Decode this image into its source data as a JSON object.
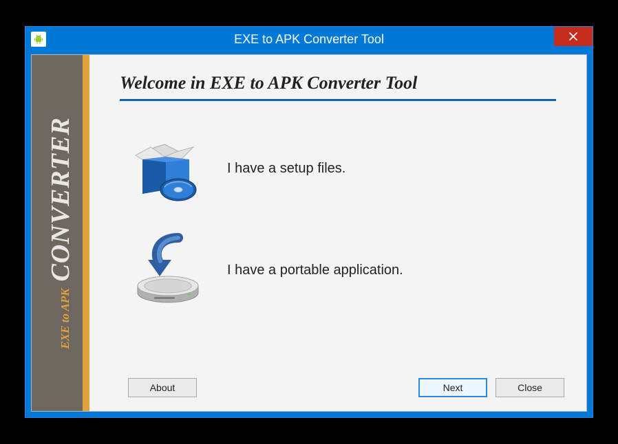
{
  "window": {
    "title": "EXE to APK Converter Tool"
  },
  "sidebar": {
    "brand_small": "EXE to APK",
    "brand_big": "CONVERTER"
  },
  "main": {
    "heading": "Welcome in EXE to APK Converter Tool",
    "options": {
      "setup": {
        "label": "I have a setup files."
      },
      "portable": {
        "label": "I have a portable application."
      }
    }
  },
  "footer": {
    "about": "About",
    "next": "Next",
    "close": "Close"
  }
}
